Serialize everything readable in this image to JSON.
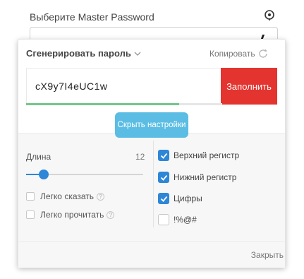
{
  "master": {
    "label": "Выберите Master Password",
    "value": ""
  },
  "generator": {
    "title": "Сгенерировать пароль",
    "copy_label": "Копировать",
    "password": "cX9y7I4eUC1w",
    "fill_label": "Заполнить",
    "strength": 0.78,
    "toggle_label": "Скрыть настройки"
  },
  "settings": {
    "length_label": "Длина",
    "length_value": "12",
    "length_slider_fraction": 0.15,
    "easy_say_label": "Легко сказать",
    "easy_read_label": "Легко прочитать",
    "help_glyph": "?",
    "uppercase_label": "Верхний регистр",
    "lowercase_label": "Нижний регистр",
    "digits_label": "Цифры",
    "symbols_label": "!%@#",
    "easy_say_checked": false,
    "easy_read_checked": false,
    "uppercase_checked": true,
    "lowercase_checked": true,
    "digits_checked": true,
    "symbols_checked": false
  },
  "footer": {
    "close_label": "Закрыть"
  },
  "colors": {
    "fill_button": "#e3342f",
    "accent": "#2e86d7",
    "toggle_button": "#5bbde3",
    "strength": "#75c58a"
  }
}
